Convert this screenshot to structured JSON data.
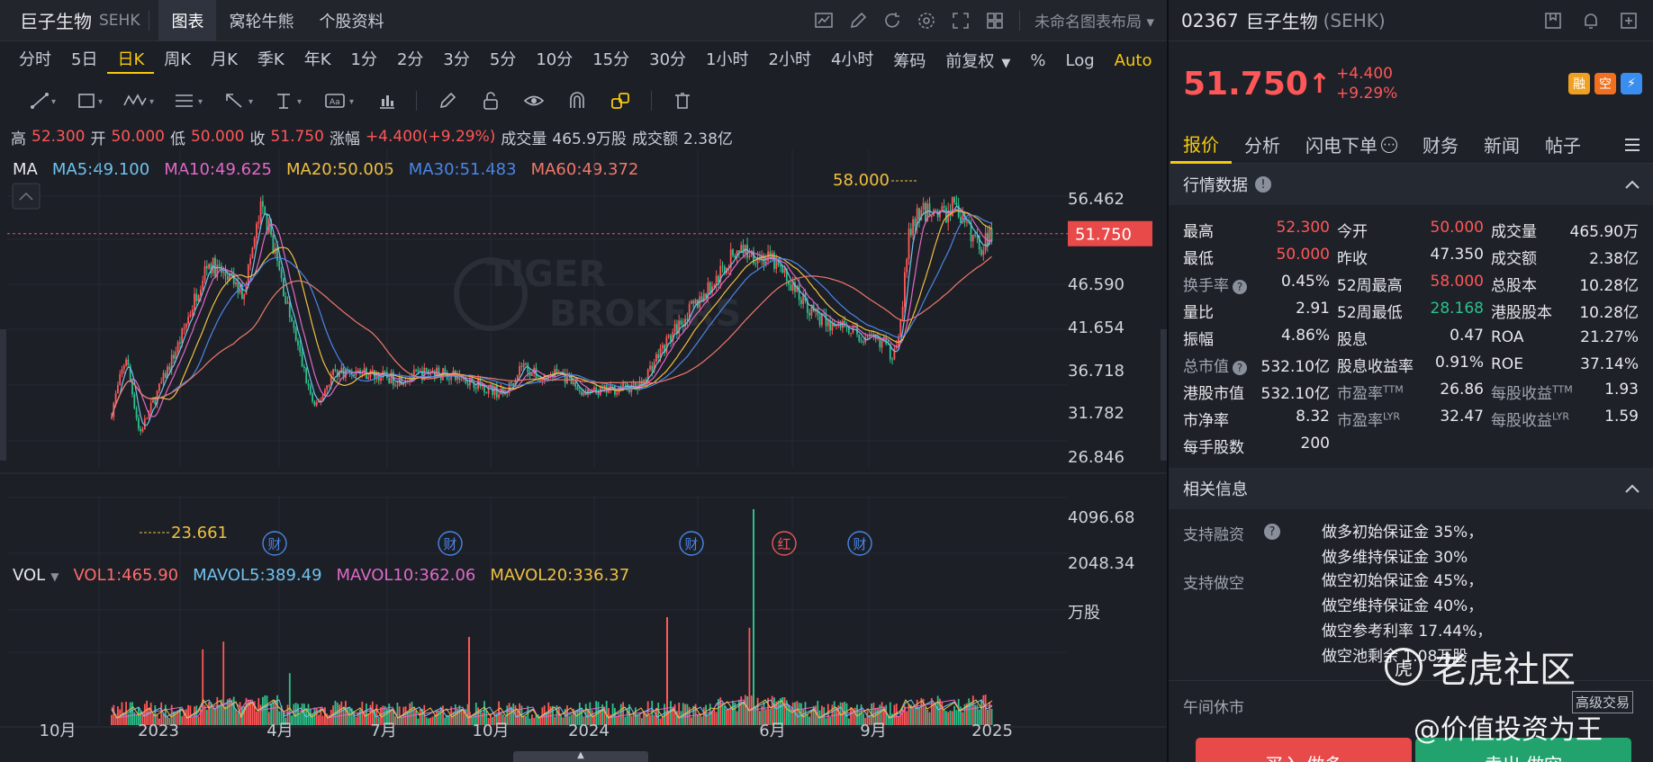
{
  "header": {
    "name": "巨子生物",
    "exchange": "SEHK",
    "tabs": [
      "图表",
      "窝轮牛熊",
      "个股资料"
    ],
    "layout_name": "未命名图表布局"
  },
  "periods": [
    "分时",
    "5日",
    "日K",
    "周K",
    "月K",
    "季K",
    "年K",
    "1分",
    "2分",
    "3分",
    "5分",
    "10分",
    "15分",
    "30分",
    "1小时",
    "2小时",
    "4小时"
  ],
  "period_right": {
    "chip": "筹码",
    "adjust": "前复权",
    "pct": "%",
    "log": "Log",
    "auto": "Auto"
  },
  "ohlc": {
    "high_label": "高",
    "high": "52.300",
    "open_label": "开",
    "open": "50.000",
    "low_label": "低",
    "low": "50.000",
    "close_label": "收",
    "close": "51.750",
    "chg_label": "涨幅",
    "chg": "+4.400(+9.29%)",
    "vol_label": "成交量",
    "vol": "465.9万股",
    "amt_label": "成交额",
    "amt": "2.38亿"
  },
  "ma": {
    "label": "MA",
    "items": [
      {
        "text": "MA5:49.100",
        "color": "#6fc3f0"
      },
      {
        "text": "MA10:49.625",
        "color": "#e069c8"
      },
      {
        "text": "MA20:50.005",
        "color": "#f0c040"
      },
      {
        "text": "MA30:51.483",
        "color": "#4a86e8"
      },
      {
        "text": "MA60:49.372",
        "color": "#f0786a"
      }
    ]
  },
  "vol_legend": {
    "label": "VOL",
    "items": [
      {
        "text": "VOL1:465.90",
        "color": "#ff6b6b"
      },
      {
        "text": "MAVOL5:389.49",
        "color": "#6fc3f0"
      },
      {
        "text": "MAVOL10:362.06",
        "color": "#e069c8"
      },
      {
        "text": "MAVOL20:336.37",
        "color": "#f0c040"
      }
    ]
  },
  "chart_data": {
    "type": "candlestick",
    "price_ticks": [
      "56.462",
      "51.750",
      "46.590",
      "41.654",
      "36.718",
      "31.782",
      "26.846"
    ],
    "volume_ticks": [
      "4096.68",
      "2048.34",
      "万股"
    ],
    "x_ticks": [
      "10月",
      "2023",
      "4月",
      "7月",
      "10月",
      "2024",
      "4月",
      "6月",
      "9月",
      "2025"
    ],
    "current_price": "51.750",
    "max_label": "58.000",
    "min_label": "23.661",
    "event_markers": [
      "财",
      "财",
      "财",
      "红",
      "财"
    ],
    "watermark": "TIGER BROKERS"
  },
  "quote": {
    "code": "02367",
    "name": "巨子生物",
    "exchange": "(SEHK)",
    "price": "51.750",
    "arrow": "↑",
    "chg": "+4.400",
    "chg_pct": "+9.29%",
    "badges": [
      {
        "t": "融",
        "color": "#f0a020"
      },
      {
        "t": "空",
        "color": "#f07020"
      },
      {
        "t": "⚡",
        "color": "#3a8ef0"
      }
    ],
    "tabs": [
      "报价",
      "分析",
      "闪电下单",
      "财务",
      "新闻",
      "帖子"
    ]
  },
  "market_data": {
    "title": "行情数据",
    "rows": [
      [
        {
          "k": "最高",
          "v": "52.300",
          "c": "red"
        },
        {
          "k": "今开",
          "v": "50.000",
          "c": "red"
        },
        {
          "k": "成交量",
          "v": "465.90万"
        }
      ],
      [
        {
          "k": "最低",
          "v": "50.000",
          "c": "red"
        },
        {
          "k": "昨收",
          "v": "47.350"
        },
        {
          "k": "成交额",
          "v": "2.38亿"
        }
      ],
      [
        {
          "k": "换手率",
          "v": "0.45%",
          "info": true
        },
        {
          "k": "52周最高",
          "v": "58.000",
          "c": "red"
        },
        {
          "k": "总股本",
          "v": "10.28亿"
        }
      ],
      [
        {
          "k": "量比",
          "v": "2.91"
        },
        {
          "k": "52周最低",
          "v": "28.168",
          "c": "grn"
        },
        {
          "k": "港股股本",
          "v": "10.28亿"
        }
      ],
      [
        {
          "k": "振幅",
          "v": "4.86%"
        },
        {
          "k": "股息",
          "v": "0.47"
        },
        {
          "k": "ROA",
          "v": "21.27%"
        }
      ],
      [
        {
          "k": "总市值",
          "v": "532.10亿",
          "info": true
        },
        {
          "k": "股息收益率",
          "v": "0.91%"
        },
        {
          "k": "ROE",
          "v": "37.14%"
        }
      ],
      [
        {
          "k": "港股市值",
          "v": "532.10亿"
        },
        {
          "k": "市盈率",
          "sup": "TTM",
          "v": "26.86"
        },
        {
          "k": "每股收益",
          "sup": "TTM",
          "v": "1.93"
        }
      ],
      [
        {
          "k": "市净率",
          "v": "8.32"
        },
        {
          "k": "市盈率",
          "sup": "LYR",
          "v": "32.47"
        },
        {
          "k": "每股收益",
          "sup": "LYR",
          "v": "1.59"
        }
      ],
      [
        {
          "k": "每手股数",
          "v": "200"
        }
      ]
    ]
  },
  "related": {
    "title": "相关信息",
    "margin_label": "支持融资",
    "margin_lines": [
      "做多初始保证金 35%，",
      "做多维持保证金 30%"
    ],
    "short_label": "支持做空",
    "short_lines": [
      "做空初始保证金 45%，",
      "做空维持保证金 40%，",
      "做空参考利率 17.44%，",
      "做空池剩余 1.08万股"
    ]
  },
  "footer": {
    "status": "午间休市",
    "advanced": "高级交易",
    "buy": "买入 做多",
    "sell": "卖出 做空",
    "wm1": "老虎社区",
    "wm2": "@价值投资为王"
  }
}
